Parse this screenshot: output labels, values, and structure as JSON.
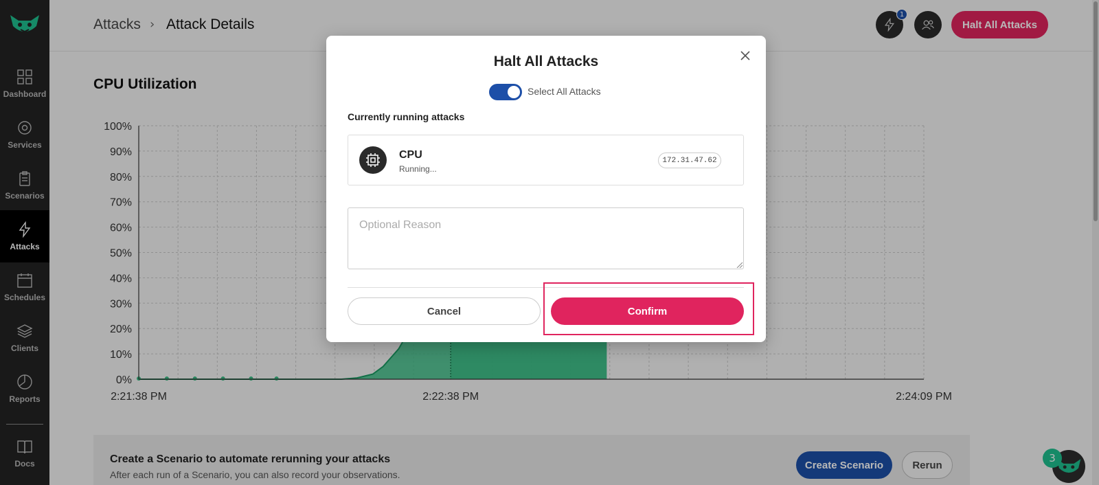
{
  "sidebar": {
    "items": [
      {
        "label": "Dashboard",
        "icon": "dashboard-icon"
      },
      {
        "label": "Services",
        "icon": "services-icon"
      },
      {
        "label": "Scenarios",
        "icon": "clipboard-icon"
      },
      {
        "label": "Attacks",
        "icon": "lightning-icon",
        "active": true
      },
      {
        "label": "Schedules",
        "icon": "calendar-icon"
      },
      {
        "label": "Clients",
        "icon": "layers-icon"
      },
      {
        "label": "Reports",
        "icon": "pie-chart-icon"
      },
      {
        "label": "Docs",
        "icon": "book-icon"
      }
    ]
  },
  "header": {
    "breadcrumb_root": "Attacks",
    "breadcrumb_sep": "›",
    "breadcrumb_current": "Attack Details",
    "notification_count": "1",
    "halt_all_label": "Halt All Attacks"
  },
  "section": {
    "title": "CPU Utilization"
  },
  "chart_data": {
    "type": "area",
    "title": "CPU Utilization",
    "y_ticks": [
      "100%",
      "90%",
      "80%",
      "70%",
      "60%",
      "50%",
      "40%",
      "30%",
      "20%",
      "10%",
      "0%"
    ],
    "ylim": [
      0,
      100
    ],
    "x_ticks": [
      "2:21:38 PM",
      "2:22:38 PM",
      "2:24:09 PM"
    ],
    "x_seconds_since_start": [
      0,
      5,
      10,
      15,
      20,
      25,
      30,
      33,
      36,
      39,
      42,
      45,
      47,
      50,
      55,
      60,
      65,
      70,
      75,
      80,
      85,
      90
    ],
    "x_range_seconds": [
      0,
      151
    ],
    "values": [
      0,
      0,
      0,
      0,
      0,
      0,
      0,
      0,
      0,
      0,
      0.5,
      2,
      5,
      12,
      30,
      55,
      78,
      92,
      99,
      100,
      100,
      100
    ],
    "marker_points_seconds": [
      0,
      5.4,
      10.8,
      16.2,
      21.6,
      26.5
    ],
    "active_region_seconds": [
      60,
      90
    ],
    "line_color": "#1a9a63",
    "fill_color": "#3cbd86",
    "grid": true
  },
  "footer": {
    "title": "Create a Scenario to automate rerunning your attacks",
    "subtitle": "After each run of a Scenario, you can also record your observations.",
    "create_label": "Create Scenario",
    "rerun_label": "Rerun"
  },
  "modal": {
    "title": "Halt All Attacks",
    "toggle_label": "Select All Attacks",
    "toggle_on": true,
    "running_label": "Currently running attacks",
    "attack": {
      "name": "CPU",
      "status": "Running...",
      "ip": "172.31.47.62"
    },
    "reason_placeholder": "Optional Reason",
    "cancel_label": "Cancel",
    "confirm_label": "Confirm"
  },
  "chat_count": "3",
  "colors": {
    "accent": "#e0245e",
    "primary": "#1d4fa8",
    "sidebar": "#232323"
  }
}
